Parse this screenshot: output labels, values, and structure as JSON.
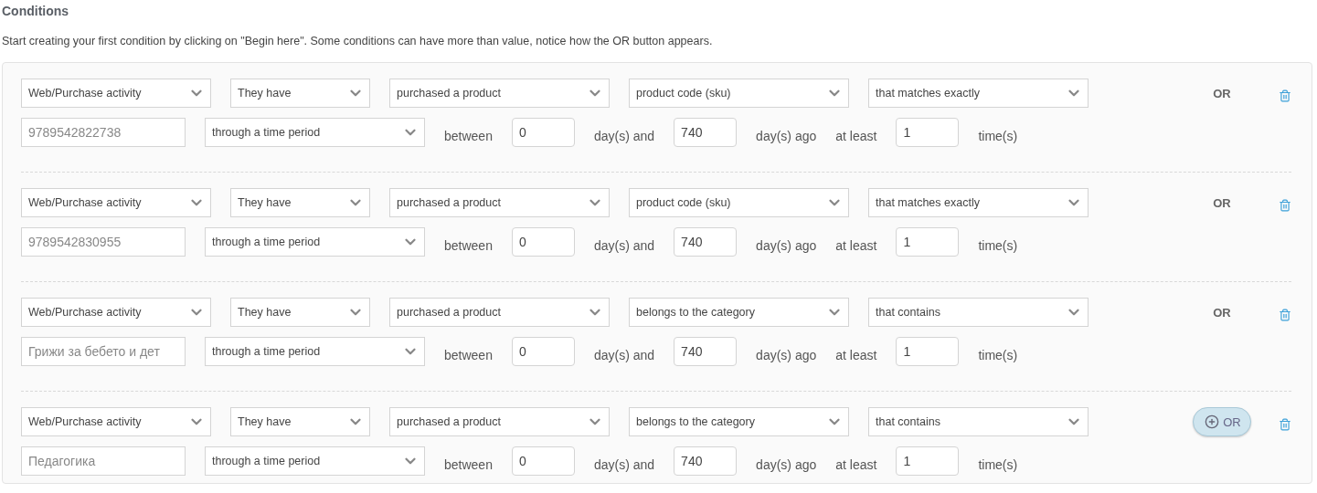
{
  "heading": "Conditions",
  "description": "Start creating your first condition by clicking on \"Begin here\". Some conditions can have more than value, notice how the OR button appears.",
  "conditions": [
    {
      "selects": [
        "Web/Purchase activity",
        "They have",
        "purchased a product",
        "product code (sku)",
        "that matches exactly"
      ],
      "value": "9789542822738",
      "period": "through a time period",
      "between": "between",
      "from": "0",
      "days_and": "day(s) and",
      "to": "740",
      "days_ago": "day(s) ago",
      "at_least": "at least",
      "count": "1",
      "times": "time(s)",
      "or": {
        "kind": "label",
        "label": "OR"
      }
    },
    {
      "selects": [
        "Web/Purchase activity",
        "They have",
        "purchased a product",
        "product code (sku)",
        "that matches exactly"
      ],
      "value": "9789542830955",
      "period": "through a time period",
      "between": "between",
      "from": "0",
      "days_and": "day(s) and",
      "to": "740",
      "days_ago": "day(s) ago",
      "at_least": "at least",
      "count": "1",
      "times": "time(s)",
      "or": {
        "kind": "label",
        "label": "OR"
      }
    },
    {
      "selects": [
        "Web/Purchase activity",
        "They have",
        "purchased a product",
        "belongs to the category",
        "that contains"
      ],
      "value": "Грижи за бебето и дет",
      "period": "through a time period",
      "between": "between",
      "from": "0",
      "days_and": "day(s) and",
      "to": "740",
      "days_ago": "day(s) ago",
      "at_least": "at least",
      "count": "1",
      "times": "time(s)",
      "or": {
        "kind": "label",
        "label": "OR"
      }
    },
    {
      "selects": [
        "Web/Purchase activity",
        "They have",
        "purchased a product",
        "belongs to the category",
        "that contains"
      ],
      "value": "Педагогика",
      "period": "through a time period",
      "between": "between",
      "from": "0",
      "days_and": "day(s) and",
      "to": "740",
      "days_ago": "day(s) ago",
      "at_least": "at least",
      "count": "1",
      "times": "time(s)",
      "or": {
        "kind": "button",
        "label": "OR"
      }
    }
  ]
}
